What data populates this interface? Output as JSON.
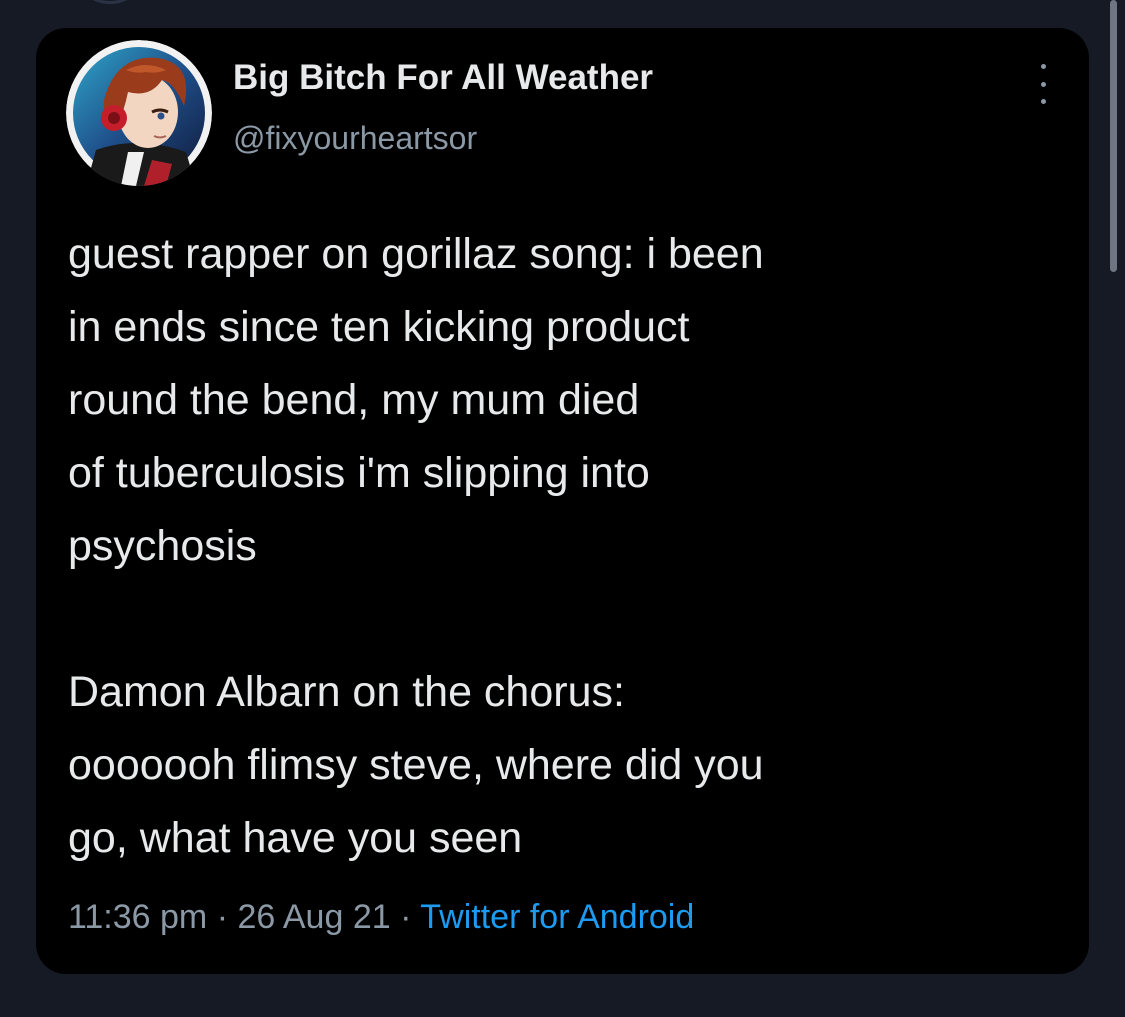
{
  "tweet": {
    "display_name": "Big Bitch For All Weather",
    "handle": "@fixyourheartsor",
    "body": {
      "paragraph1": [
        "guest rapper on gorillaz song: i been",
        "in ends since ten kicking product",
        "round the bend, my mum died",
        "of tuberculosis i'm slipping into",
        "psychosis"
      ],
      "paragraph2": [
        "Damon Albarn on the chorus:",
        "ooooooh flimsy steve, where did you",
        "go, what have you seen"
      ]
    },
    "time": "11:36 pm",
    "separator": "·",
    "date": "26 Aug 21",
    "source": "Twitter for Android"
  },
  "icons": {
    "more": "more-vertical-icon",
    "avatar": "profile-avatar-image"
  },
  "colors": {
    "page_background": "#151a24",
    "card_background": "#000000",
    "primary_text": "#e7e9ea",
    "secondary_text": "#8b98a5",
    "link": "#1d9bf0"
  }
}
